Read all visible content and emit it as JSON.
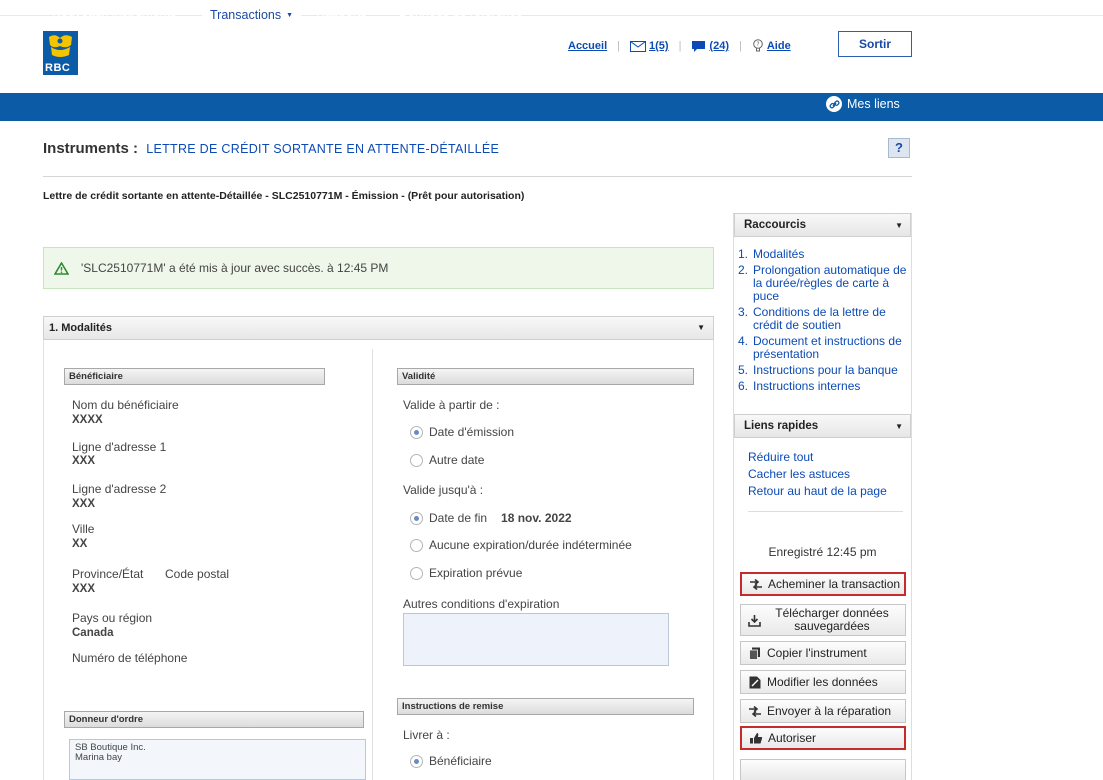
{
  "brand": {
    "logo_text": "RBC",
    "primary_color": "#0b5ba6",
    "link_color": "#0c4bb5"
  },
  "toplinks": {
    "accueil": "Accueil",
    "messages": "1(5)",
    "notifications": "(24)",
    "aide": "Aide",
    "sortir": "Sortir"
  },
  "nav": {
    "items": [
      {
        "label": "Nouveaux instruments"
      },
      {
        "label": "Transactions"
      },
      {
        "label": "Rapports"
      },
      {
        "label": "Données de référence"
      }
    ],
    "mes_liens": "Mes liens"
  },
  "page": {
    "title_prefix": "Instruments :",
    "title_link": "LETTRE DE CRÉDIT SORTANTE EN ATTENTE-DÉTAILLÉE",
    "help": "?",
    "subtitle": "Lettre de crédit sortante en attente-Détaillée - SLC2510771M - Émission - (Prêt pour autorisation)",
    "success_message": "'SLC2510771M' a été mis à jour avec succès. à 12:45 PM"
  },
  "section": {
    "title": "1. Modalités",
    "beneficiaire": {
      "header": "Bénéficiaire",
      "nom_label": "Nom du bénéficiaire",
      "nom_value": "XXXX",
      "adresse1_label": "Ligne d'adresse 1",
      "adresse1_value": "XXX",
      "adresse2_label": "Ligne d'adresse 2",
      "adresse2_value": "XXX",
      "ville_label": "Ville",
      "ville_value": "XX",
      "province_label": "Province/État",
      "code_postal_label": "Code postal",
      "province_value": "XXX",
      "pays_label": "Pays ou région",
      "pays_value": "Canada",
      "telephone_label": "Numéro de téléphone"
    },
    "donneur": {
      "header": "Donneur d'ordre",
      "address_line1": "SB Boutique Inc.",
      "address_line2": "Marina bay"
    },
    "validite": {
      "header": "Validité",
      "from_label": "Valide à partir de :",
      "opt_emission": "Date d'émission",
      "opt_autre": "Autre date",
      "until_label": "Valide jusqu'à :",
      "opt_fin": "Date de fin",
      "fin_value": "18 nov. 2022",
      "opt_aucune": "Aucune expiration/durée indéterminée",
      "opt_prevue": "Expiration prévue",
      "autres_label": "Autres conditions d'expiration"
    },
    "remise": {
      "header": "Instructions de remise",
      "livrer_label": "Livrer à :",
      "opt_beneficiaire": "Bénéficiaire"
    }
  },
  "sidebar": {
    "raccourcis_header": "Raccourcis",
    "shortcuts": [
      {
        "num": "1.",
        "label": "Modalités"
      },
      {
        "num": "2.",
        "label": "Prolongation automatique de la durée/règles de carte à puce"
      },
      {
        "num": "3.",
        "label": "Conditions de la lettre de crédit de soutien"
      },
      {
        "num": "4.",
        "label": "Document et instructions de présentation"
      },
      {
        "num": "5.",
        "label": "Instructions pour la banque"
      },
      {
        "num": "6.",
        "label": "Instructions internes"
      }
    ],
    "liens_header": "Liens rapides",
    "quick_links": [
      "Réduire tout",
      "Cacher les astuces",
      "Retour au haut de la page"
    ],
    "saved_text": "Enregistré 12:45 pm",
    "actions": {
      "acheminer": "Acheminer la transaction",
      "telecharger": "Télécharger données sauvegardées",
      "copier": "Copier l'instrument",
      "modifier": "Modifier les données",
      "envoyer": "Envoyer à la réparation",
      "autoriser": "Autoriser"
    },
    "highlight_color": "#c52b2b"
  }
}
